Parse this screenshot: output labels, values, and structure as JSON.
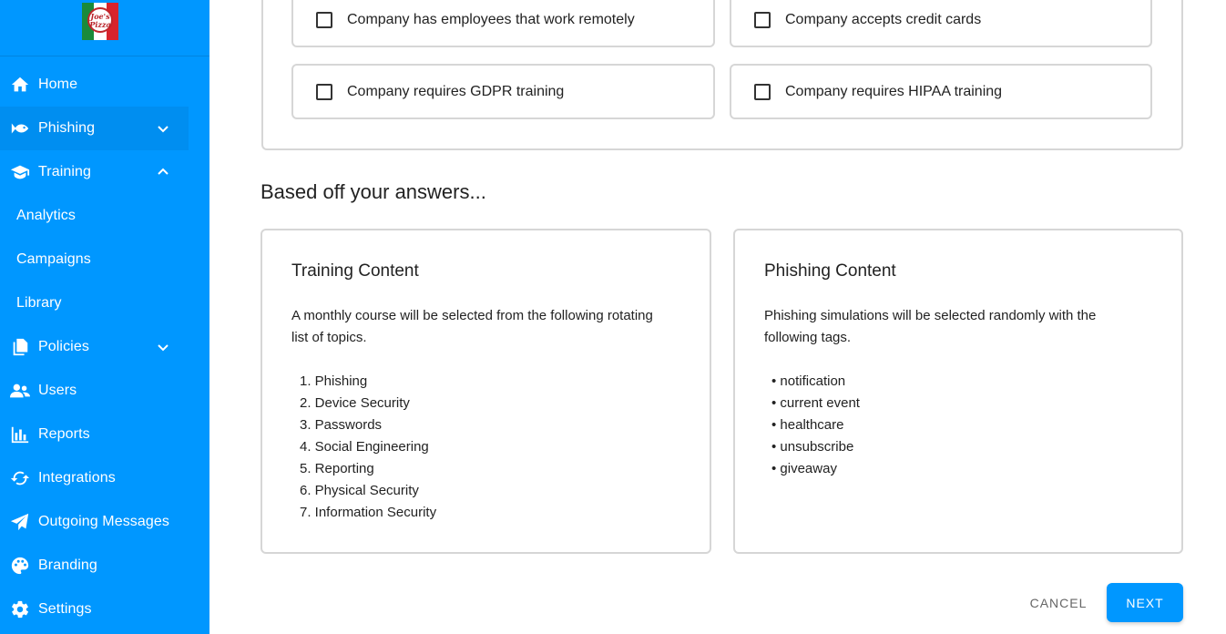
{
  "logo": {
    "text_line1": "Joe's",
    "text_line2": "Pizza"
  },
  "sidebar": {
    "items": [
      {
        "label": "Home",
        "icon": "home-icon"
      },
      {
        "label": "Phishing",
        "icon": "fish-icon",
        "chevron": "chevron-down-icon"
      },
      {
        "label": "Training",
        "icon": "graduation-cap-icon",
        "chevron": "chevron-up-icon"
      },
      {
        "label": "Analytics"
      },
      {
        "label": "Campaigns"
      },
      {
        "label": "Library"
      },
      {
        "label": "Policies",
        "icon": "documents-icon",
        "chevron": "chevron-down-icon"
      },
      {
        "label": "Users",
        "icon": "users-icon"
      },
      {
        "label": "Reports",
        "icon": "bar-chart-icon"
      },
      {
        "label": "Integrations",
        "icon": "sync-icon"
      },
      {
        "label": "Outgoing Messages",
        "icon": "paper-plane-icon"
      },
      {
        "label": "Branding",
        "icon": "palette-icon"
      },
      {
        "label": "Settings",
        "icon": "gear-icon"
      }
    ]
  },
  "options": [
    {
      "label": "Company has employees that work remotely",
      "checked": false
    },
    {
      "label": "Company accepts credit cards",
      "checked": false
    },
    {
      "label": "Company requires GDPR training",
      "checked": false
    },
    {
      "label": "Company requires HIPAA training",
      "checked": false
    }
  ],
  "results": {
    "heading": "Based off your answers...",
    "training": {
      "title": "Training Content",
      "description": "A monthly course will be selected from the following rotating list of topics.",
      "topics": [
        "1. Phishing",
        "2. Device Security",
        "3. Passwords",
        "4. Social Engineering",
        "5. Reporting",
        "6. Physical Security",
        "7. Information Security"
      ]
    },
    "phishing": {
      "title": "Phishing Content",
      "description": "Phishing simulations will be selected randomly with the following tags.",
      "tags": [
        "• notification",
        "• current event",
        "• healthcare",
        "• unsubscribe",
        "• giveaway"
      ]
    }
  },
  "actions": {
    "cancel_label": "CANCEL",
    "next_label": "NEXT"
  },
  "colors": {
    "sidebar": "#0097ff",
    "primary": "#0097ff",
    "border": "#d6d6d6"
  }
}
